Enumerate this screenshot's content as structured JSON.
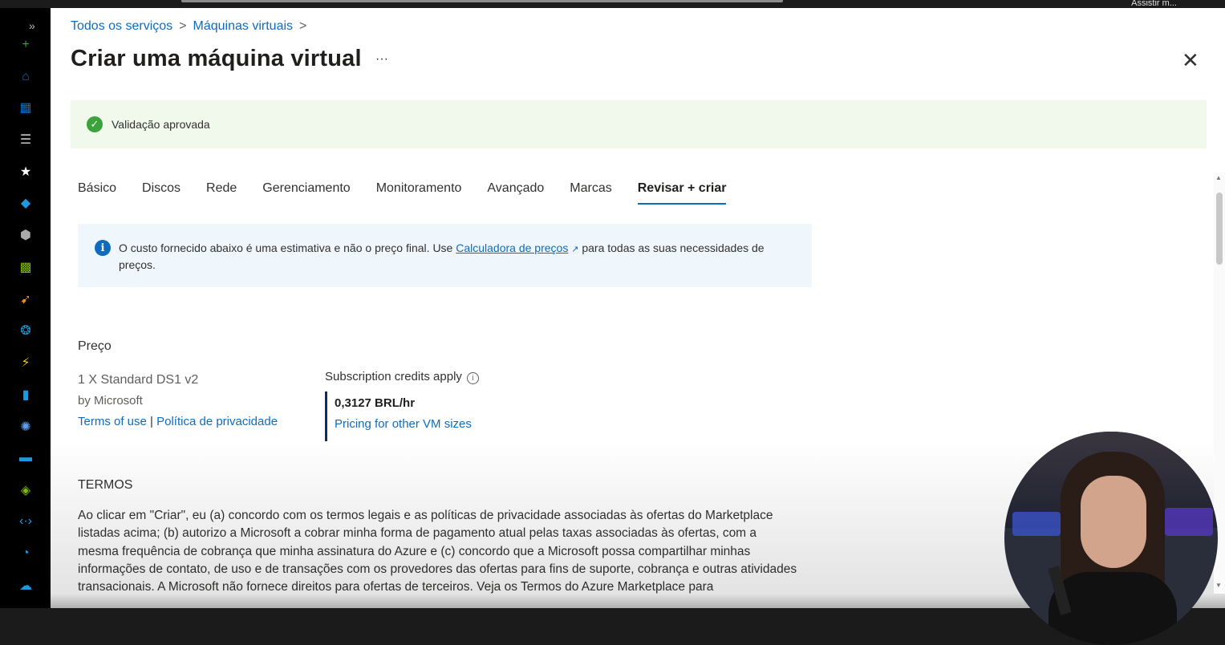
{
  "topbar": {
    "right_text": "Assistir m..."
  },
  "nav": {
    "expand_glyph": "»",
    "items": [
      {
        "icon": "plus-icon",
        "glyph": "+",
        "color": "#3ca23c"
      },
      {
        "icon": "home-icon",
        "glyph": "⌂",
        "color": "#0f6cbd"
      },
      {
        "icon": "dashboard-icon",
        "glyph": "▦",
        "color": "#0f6cbd"
      },
      {
        "icon": "all-services-icon",
        "glyph": "☰",
        "color": "#c8c8c8"
      },
      {
        "icon": "favorites-star-icon",
        "glyph": "★",
        "color": "#ffffff"
      },
      {
        "icon": "resource-groups-icon",
        "glyph": "◆",
        "color": "#1a9ae0"
      },
      {
        "icon": "resource-icon",
        "glyph": "⬢",
        "color": "#aaa"
      },
      {
        "icon": "all-resources-icon",
        "glyph": "▩",
        "color": "#7fba00"
      },
      {
        "icon": "quickstart-icon",
        "glyph": "➹",
        "color": "#ff8c00"
      },
      {
        "icon": "virtual-network-icon",
        "glyph": "❂",
        "color": "#1a9ae0"
      },
      {
        "icon": "function-app-icon",
        "glyph": "⚡",
        "color": "#f2c811"
      },
      {
        "icon": "sql-database-icon",
        "glyph": "▮",
        "color": "#1a9ae0"
      },
      {
        "icon": "cosmos-db-icon",
        "glyph": "✺",
        "color": "#5ea0ef"
      },
      {
        "icon": "virtual-machine-icon",
        "glyph": "▬",
        "color": "#1a9ae0"
      },
      {
        "icon": "load-balancer-icon",
        "glyph": "◈",
        "color": "#7fba00"
      },
      {
        "icon": "code-icon",
        "glyph": "‹·›",
        "color": "#1a9ae0"
      },
      {
        "icon": "monitor-icon",
        "glyph": "◔",
        "color": "#1a9ae0"
      },
      {
        "icon": "advisor-icon",
        "glyph": "☁",
        "color": "#1a9ae0"
      }
    ]
  },
  "breadcrumb": [
    "Todos os serviços",
    "Máquinas virtuais"
  ],
  "breadcrumb_sep": ">",
  "page_title": "Criar uma máquina virtual",
  "more_label": "···",
  "close_label": "✕",
  "validation": {
    "icon_glyph": "✓",
    "text": "Validação aprovada"
  },
  "tabs": [
    "Básico",
    "Discos",
    "Rede",
    "Gerenciamento",
    "Monitoramento",
    "Avançado",
    "Marcas",
    "Revisar + criar"
  ],
  "info": {
    "icon_glyph": "i",
    "text_before": "O custo fornecido abaixo é uma estimativa e não o preço final. Use",
    "link": "Calculadora de preços",
    "external_glyph": "↗",
    "text_after": "para todas as suas necessidades de preços."
  },
  "price": {
    "heading": "Preço",
    "product": "1 X Standard DS1 v2",
    "publisher": "by Microsoft",
    "terms_link": "Terms of use",
    "divider": "|",
    "privacy_link": "Política de privacidade",
    "credits": "Subscription credits apply",
    "credits_info": "i",
    "cost": "0,3127 BRL/hr",
    "other_sizes": "Pricing for other VM sizes"
  },
  "terms": {
    "heading": "TERMOS",
    "body": "Ao clicar em \"Criar\", eu (a) concordo com os termos legais e as políticas de privacidade associadas às ofertas do Marketplace listadas acima; (b) autorizo a Microsoft a cobrar minha forma de pagamento atual pelas taxas associadas às ofertas, com a mesma frequência de cobrança que minha assinatura do Azure e (c) concordo que a Microsoft possa compartilhar minhas informações de contato, de uso e de transações com os provedores das ofertas para fins de suporte, cobrança e outras atividades transacionais. A Microsoft não fornece direitos para ofertas de terceiros. Veja os Termos do Azure Marketplace para"
  },
  "colors": {
    "accent": "#0f6cbd",
    "success": "#3ca23c",
    "validation_bg": "#f1f8ec",
    "info_bg": "#eff6fc"
  }
}
